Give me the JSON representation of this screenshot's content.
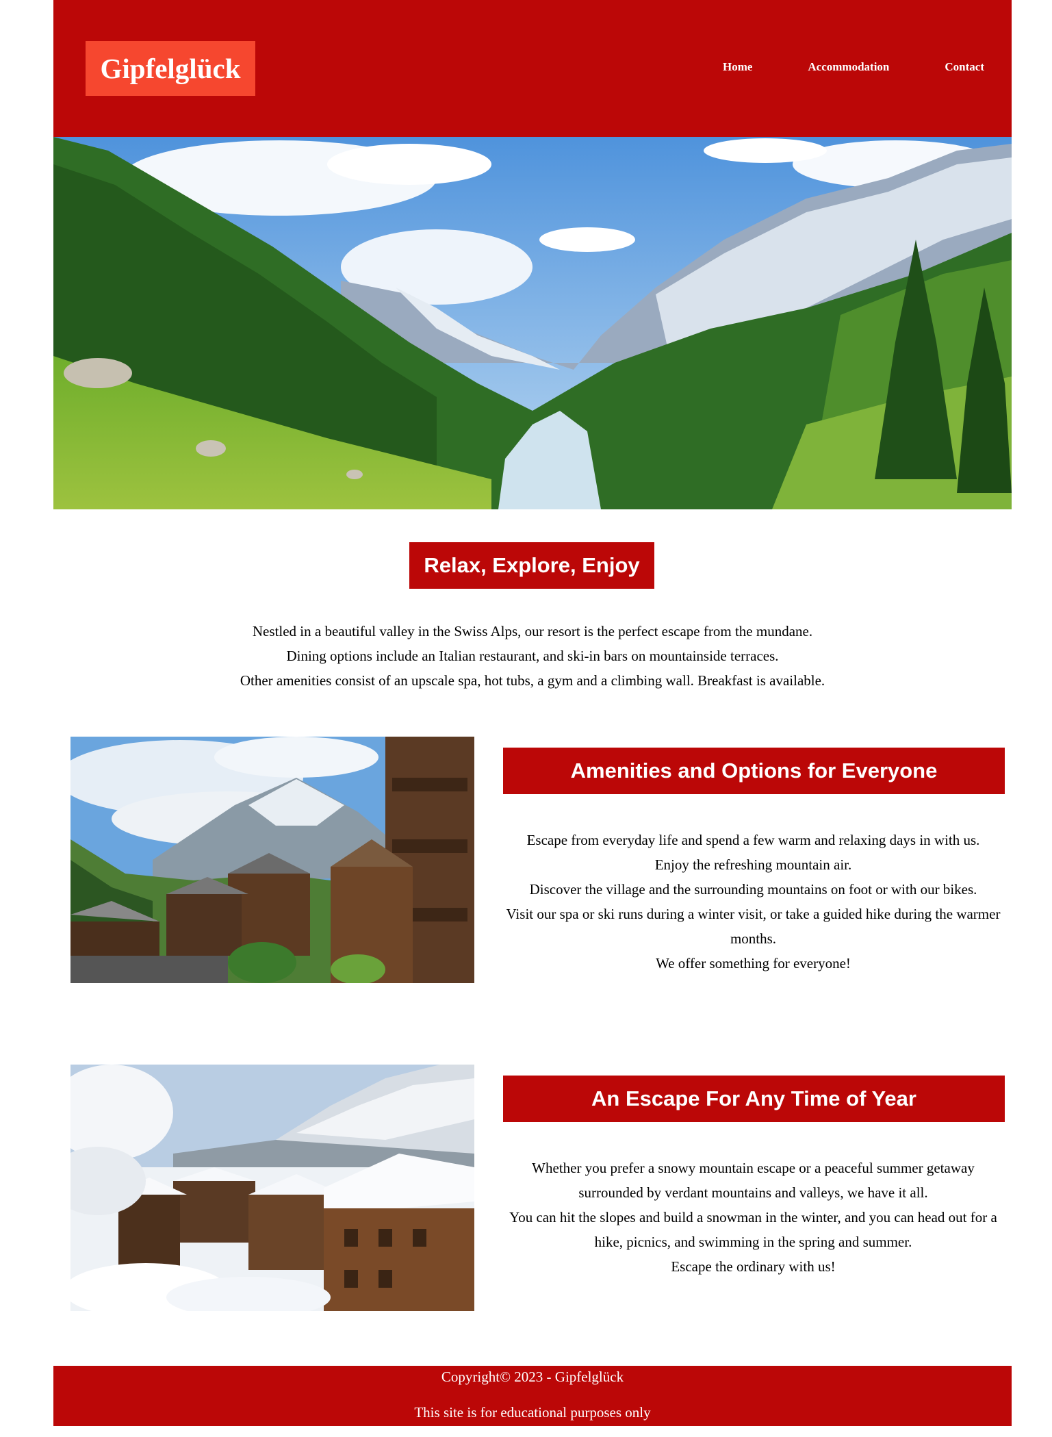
{
  "header": {
    "logo": "Gipfelglück",
    "nav": [
      "Home",
      "Accommodation",
      "Contact"
    ],
    "background_color": "#bb0707",
    "logo_color": "#f6472f"
  },
  "hero": {
    "image": "swiss-alps-valley-photo"
  },
  "intro": {
    "heading": "Relax, Explore, Enjoy",
    "paragraphs": [
      "Nestled in a beautiful valley in the Swiss Alps, our resort is the perfect escape from the mundane.",
      "Dining options include an Italian restaurant, and ski-in bars on mountainside terraces.",
      "Other amenities consist of an upscale spa, hot tubs, a gym and a climbing wall. Breakfast is available."
    ]
  },
  "sections": [
    {
      "image": "alpine-village-summer-photo",
      "heading": "Amenities and Options for Everyone",
      "paragraphs": [
        "Escape from everyday life and spend a few warm and relaxing days in with us.",
        "Enjoy the refreshing mountain air.",
        "Discover the village and the surrounding mountains on foot or with our bikes.",
        "Visit our spa or ski runs during a winter visit, or take a guided hike during the warmer months.",
        "We offer something for everyone!"
      ]
    },
    {
      "image": "alpine-village-winter-photo",
      "heading": "An Escape For Any Time of Year",
      "paragraphs": [
        "Whether you prefer a snowy mountain escape or a peaceful summer getaway surrounded by verdant mountains and valleys, we have it all.",
        "You can hit the slopes and build a snowman in the winter, and you can head out for a hike, picnics, and swimming in the spring and summer.",
        "Escape the ordinary with us!"
      ]
    }
  ],
  "footer": {
    "copyright": "Copyright© 2023 - Gipfelglück",
    "note": "This site is for educational purposes only"
  }
}
